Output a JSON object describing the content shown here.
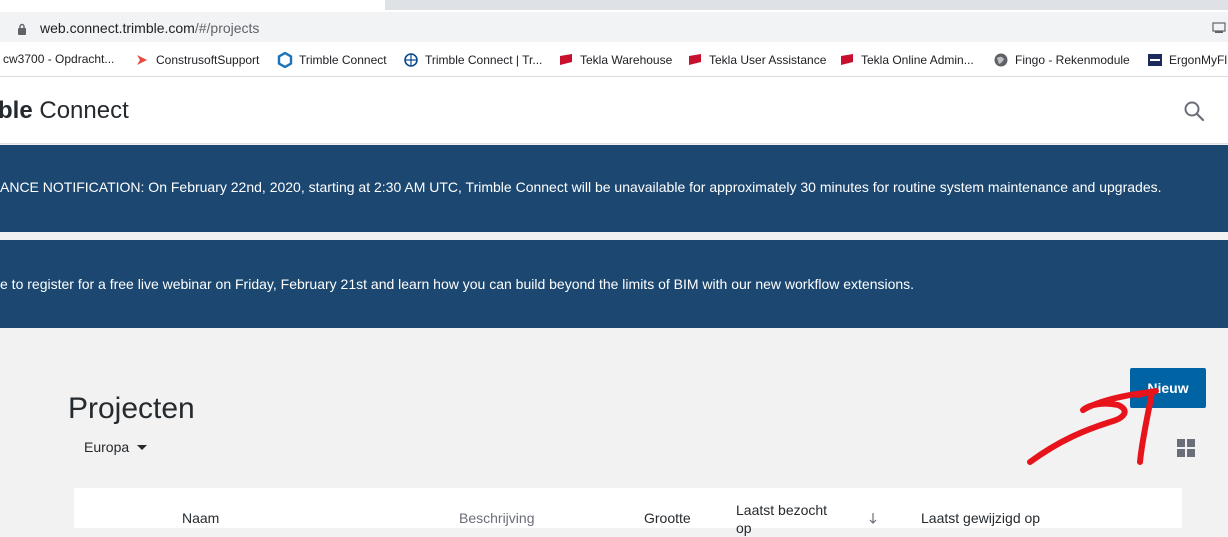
{
  "browser": {
    "url_host": "web.connect.trimble.com",
    "url_path": "/#/projects"
  },
  "bookmarks": [
    {
      "label": "cw3700 - Opdracht..."
    },
    {
      "label": "ConstrusoftSupport"
    },
    {
      "label": "Trimble Connect"
    },
    {
      "label": "Trimble Connect | Tr..."
    },
    {
      "label": "Tekla Warehouse"
    },
    {
      "label": "Tekla User Assistance"
    },
    {
      "label": "Tekla Online Admin..."
    },
    {
      "label": "Fingo - Rekenmodule"
    },
    {
      "label": "ErgonMyFl"
    }
  ],
  "header": {
    "brand_bold": "ble",
    "brand_light": " Connect"
  },
  "banners": {
    "maintenance": "ANCE NOTIFICATION: On February 22nd, 2020, starting at 2:30 AM UTC, Trimble Connect will be unavailable for approximately 30 minutes for routine system maintenance and upgrades.",
    "webinar": "e to register for a free live webinar on Friday, February 21st and learn how you can build beyond the limits of BIM with our new workflow extensions."
  },
  "main": {
    "title": "Projecten",
    "new_button": "Nieuw",
    "region": "Europa"
  },
  "table": {
    "columns": {
      "name": "Naam",
      "description": "Beschrijving",
      "size": "Grootte",
      "last_visited_1": "Laatst bezocht",
      "last_visited_2": "op",
      "last_modified": "Laatst gewijzigd op"
    }
  },
  "colors": {
    "banner": "#1b4770",
    "primary_button": "#0063a3",
    "annotation_arrow": "#e8141c"
  },
  "icons": [
    "lock-icon",
    "cast-icon",
    "search-icon",
    "caret-down-icon",
    "grid-view-icon",
    "sort-icon"
  ]
}
